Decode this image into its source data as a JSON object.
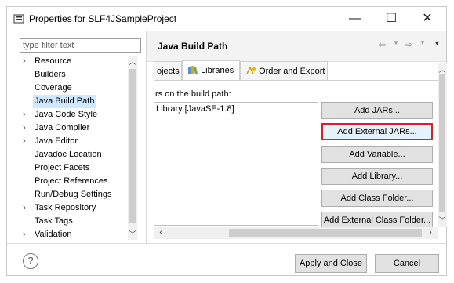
{
  "window": {
    "title": "Properties for SLF4JSampleProject",
    "minimize_glyph": "—",
    "maximize_glyph": "☐",
    "close_glyph": "✕"
  },
  "sidebar": {
    "filter_placeholder": "type filter text",
    "items": [
      {
        "label": "Resource",
        "expandable": true
      },
      {
        "label": "Builders",
        "expandable": false
      },
      {
        "label": "Coverage",
        "expandable": false
      },
      {
        "label": "Java Build Path",
        "expandable": false,
        "selected": true
      },
      {
        "label": "Java Code Style",
        "expandable": true
      },
      {
        "label": "Java Compiler",
        "expandable": true
      },
      {
        "label": "Java Editor",
        "expandable": true
      },
      {
        "label": "Javadoc Location",
        "expandable": false
      },
      {
        "label": "Project Facets",
        "expandable": false
      },
      {
        "label": "Project References",
        "expandable": false
      },
      {
        "label": "Run/Debug Settings",
        "expandable": false
      },
      {
        "label": "Task Repository",
        "expandable": true
      },
      {
        "label": "Task Tags",
        "expandable": false
      },
      {
        "label": "Validation",
        "expandable": true
      }
    ]
  },
  "page": {
    "title": "Java Build Path",
    "tabs": [
      {
        "label": "ojects",
        "active": false
      },
      {
        "label": "Libraries",
        "active": true
      },
      {
        "label": "Order and Export",
        "active": false
      }
    ],
    "content_label": "rs on the build path:",
    "library_entry": "Library [JavaSE-1.8]",
    "buttons": [
      {
        "label": "Add JARs...",
        "highlight": false
      },
      {
        "label": "Add External JARs...",
        "highlight": true
      },
      {
        "label": "Add Variable...",
        "highlight": false
      },
      {
        "label": "Add Library...",
        "highlight": false
      },
      {
        "label": "Add Class Folder...",
        "highlight": false
      },
      {
        "label": "Add External Class Folder...",
        "highlight": false
      }
    ]
  },
  "footer": {
    "apply_close": "Apply and Close",
    "cancel": "Cancel",
    "help_glyph": "?"
  },
  "colors": {
    "highlight_border": "#d0242b",
    "selection": "#cde8ff"
  }
}
